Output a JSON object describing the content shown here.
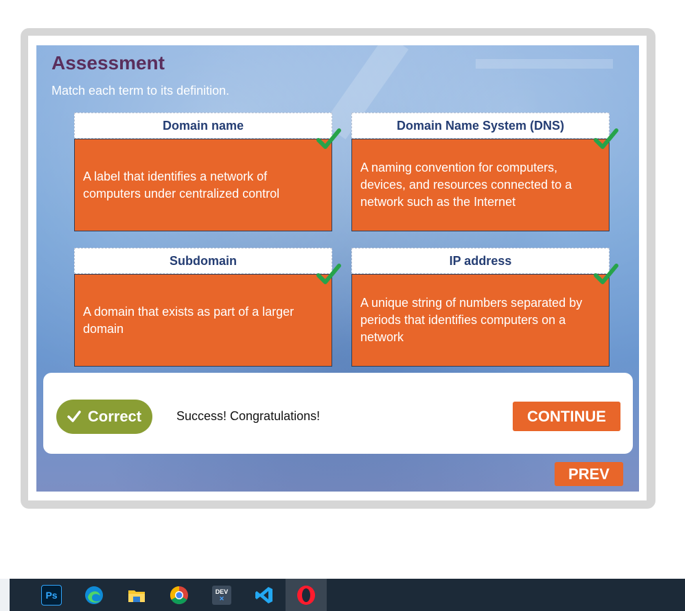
{
  "assessment": {
    "title": "Assessment",
    "instruction": "Match each term to its definition."
  },
  "cards": [
    {
      "term": "Domain name",
      "definition": "A label that identifies a network of computers under centralized control",
      "status": "correct"
    },
    {
      "term": "Domain Name System (DNS)",
      "definition": "A naming convention for computers, devices, and resources connected to a network such as the Internet",
      "status": "correct"
    },
    {
      "term": "Subdomain",
      "definition": "A domain that exists as part of a larger domain",
      "status": "correct"
    },
    {
      "term": "IP address",
      "definition": "A unique string of numbers separated by periods that identifies computers on a network",
      "status": "correct"
    }
  ],
  "feedback": {
    "badge_label": "Correct",
    "message": "Success! Congratulations!",
    "continue_label": "CONTINUE"
  },
  "navigation": {
    "prev_label": "PREV"
  },
  "taskbar": {
    "apps": [
      "photoshop-icon",
      "edge-icon",
      "file-explorer-icon",
      "chrome-icon",
      "devexpress-icon",
      "vscode-icon",
      "opera-icon"
    ],
    "photoshop_text": "Ps",
    "devexpress_text": "DEV"
  },
  "colors": {
    "accent": "#e8662a",
    "correct": "#8a9e34",
    "title": "#5a2e5c",
    "check": "#27a34a"
  }
}
